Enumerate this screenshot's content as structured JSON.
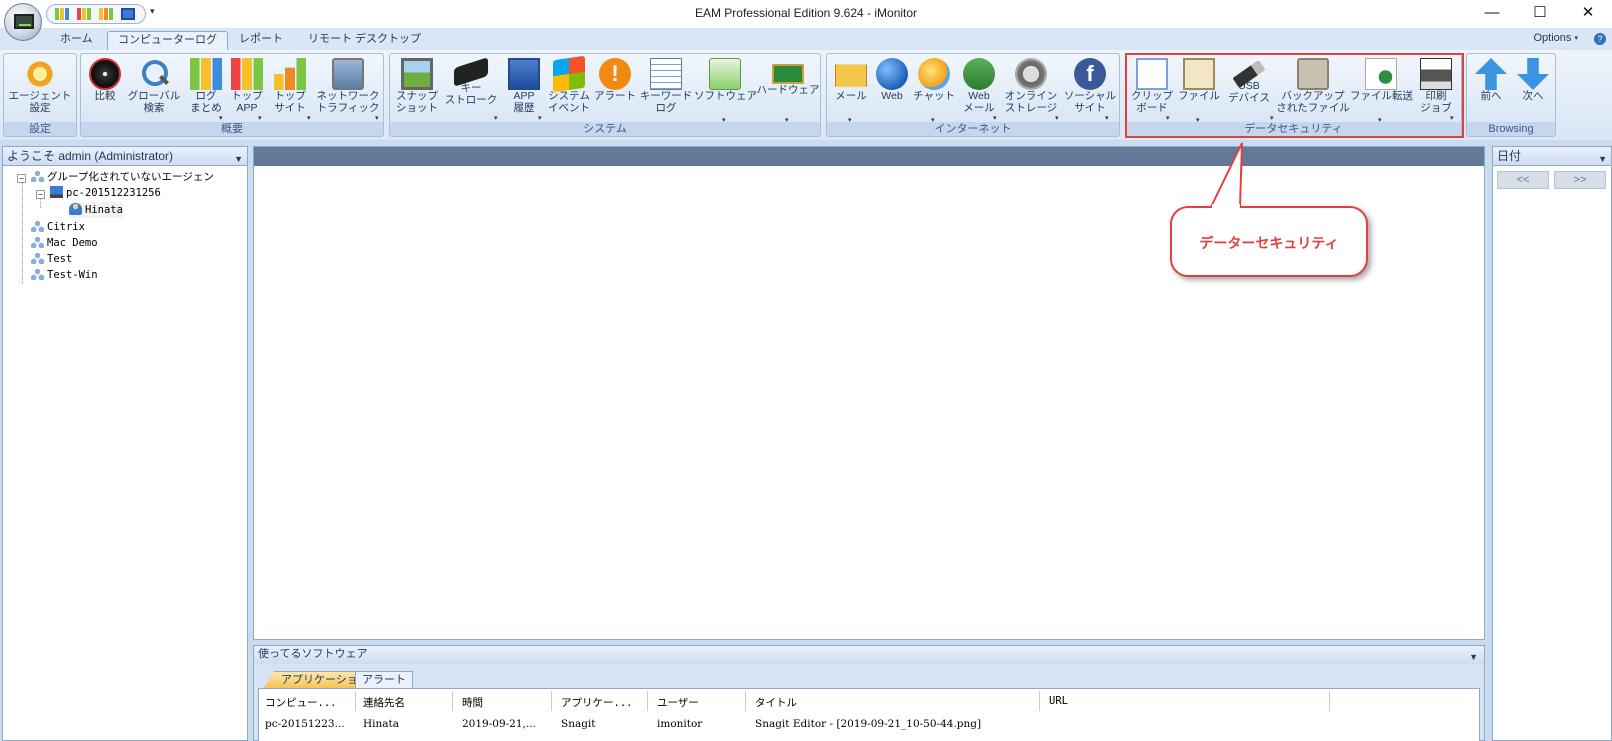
{
  "window": {
    "title": "EAM Professional Edition 9.624 - iMonitor",
    "minimize": "—",
    "maximize": "☐",
    "close": "✕"
  },
  "tabs": [
    "ホーム",
    "コンピューターログ",
    "レポート",
    "リモート デスクトップ"
  ],
  "active_tab": "コンピューターログ",
  "options_label": "Options",
  "help_glyph": "?",
  "ribbon": {
    "groups": [
      {
        "label": "設定",
        "buttons": [
          {
            "label": "エージェント\n設定",
            "icon": "agent-settings-icon"
          }
        ]
      },
      {
        "label": "概要",
        "buttons": [
          {
            "label": "比較",
            "icon": "compare-icon"
          },
          {
            "label": "グローバル\n検索",
            "icon": "global-search-icon"
          },
          {
            "label": "ログ\nまとめ",
            "icon": "log-summary-icon",
            "dropdown": true
          },
          {
            "label": "トップ\nAPP",
            "icon": "top-app-icon",
            "dropdown": true
          },
          {
            "label": "トップ\nサイト",
            "icon": "top-site-icon",
            "dropdown": true
          },
          {
            "label": "ネットワーク\nトラフィック",
            "icon": "network-traffic-icon",
            "dropdown": true
          }
        ]
      },
      {
        "label": "システム",
        "buttons": [
          {
            "label": "スナップ\nショット",
            "icon": "snapshot-icon"
          },
          {
            "label": "キー\nストローク",
            "icon": "keystroke-icon",
            "dropdown": true
          },
          {
            "label": "APP\n履歴",
            "icon": "app-history-icon",
            "dropdown": true
          },
          {
            "label": "システム\nイベント",
            "icon": "system-event-icon"
          },
          {
            "label": "アラート",
            "icon": "alert-icon"
          },
          {
            "label": "キーワード\nログ",
            "icon": "keyword-log-icon"
          },
          {
            "label": "ソフトウェア",
            "icon": "software-icon",
            "dropdown": true
          },
          {
            "label": "ハードウェア",
            "icon": "hardware-icon",
            "dropdown": true
          }
        ]
      },
      {
        "label": "インターネット",
        "buttons": [
          {
            "label": "メール",
            "icon": "mail-icon",
            "dropdown": true
          },
          {
            "label": "Web",
            "icon": "web-icon"
          },
          {
            "label": "チャット",
            "icon": "chat-icon",
            "dropdown": true
          },
          {
            "label": "Web\nメール",
            "icon": "webmail-icon",
            "dropdown": true
          },
          {
            "label": "オンライン\nストレージ",
            "icon": "online-storage-icon",
            "dropdown": true
          },
          {
            "label": "ソーシャル\nサイト",
            "icon": "social-site-icon",
            "dropdown": true
          }
        ]
      },
      {
        "label": "データセキュリティ",
        "buttons": [
          {
            "label": "クリップ\nボード",
            "icon": "clipboard-icon",
            "dropdown": true
          },
          {
            "label": "ファイル",
            "icon": "file-icon",
            "dropdown": true
          },
          {
            "label": "USB\nデバイス",
            "icon": "usb-device-icon",
            "dropdown": true
          },
          {
            "label": "バックアップ\nされたファイル",
            "icon": "backup-file-icon"
          },
          {
            "label": "ファイル転送",
            "icon": "file-transfer-icon",
            "dropdown": true
          },
          {
            "label": "印刷\nジョブ",
            "icon": "print-job-icon",
            "dropdown": true
          }
        ]
      },
      {
        "label": "Browsing",
        "buttons": [
          {
            "label": "前へ",
            "icon": "arrow-up-icon"
          },
          {
            "label": "次へ",
            "icon": "arrow-down-icon"
          }
        ]
      }
    ]
  },
  "left_panel": {
    "header": "ようこそ admin (Administrator)",
    "tree": [
      {
        "label": "グループ化されていないエージェン",
        "level": 0,
        "icon": "network-group-icon",
        "expanded": true
      },
      {
        "label": "pc-201512231256",
        "level": 1,
        "icon": "computer-icon",
        "expanded": true
      },
      {
        "label": "Hinata",
        "level": 2,
        "icon": "user-icon"
      },
      {
        "label": "Citrix",
        "level": 0,
        "icon": "network-group-icon"
      },
      {
        "label": "Mac Demo",
        "level": 0,
        "icon": "network-group-icon"
      },
      {
        "label": "Test",
        "level": 0,
        "icon": "network-group-icon"
      },
      {
        "label": "Test-Win",
        "level": 0,
        "icon": "network-group-icon"
      }
    ]
  },
  "right_panel": {
    "header": "日付",
    "prev": "<<",
    "next": ">>"
  },
  "bottom_panel": {
    "header": "使ってるソフトウェア",
    "tabs": [
      "アプリケーション",
      "アラート"
    ],
    "columns": [
      "コンピュー...",
      "連絡先名",
      "時間",
      "アプリケー...",
      "ユーザー",
      "タイトル",
      "URL"
    ],
    "rows": [
      [
        "pc-20151223...",
        "Hinata",
        "2019-09-21,...",
        "Snagit",
        "imonitor",
        "Snagit Editor - [2019-09-21_10-50-44.png]",
        ""
      ]
    ]
  },
  "callout": {
    "text": "データーセキュリティ"
  },
  "colors": {
    "highlight": "#e2403a",
    "ribbon_bg": "#dae6f5"
  }
}
